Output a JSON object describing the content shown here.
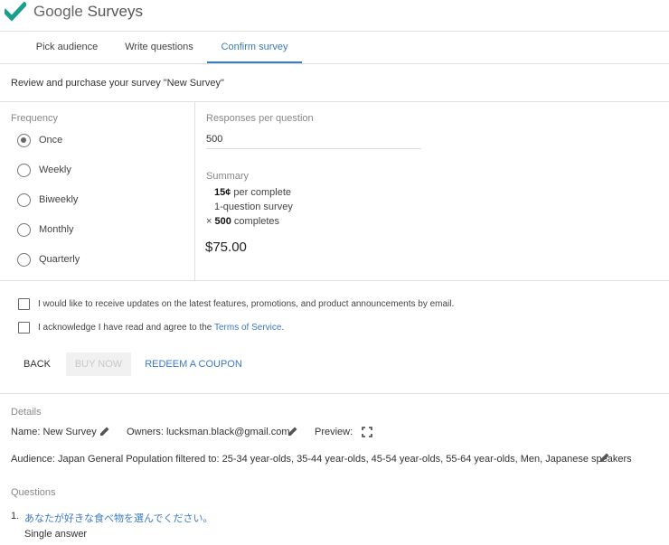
{
  "header": {
    "app_name_google": "Google",
    "app_name_product": "Surveys"
  },
  "tabs": [
    {
      "label": "Pick audience"
    },
    {
      "label": "Write questions"
    },
    {
      "label": "Confirm survey"
    }
  ],
  "review_text": "Review and purchase your survey \"New Survey\"",
  "frequency": {
    "label": "Frequency",
    "options": [
      "Once",
      "Weekly",
      "Biweekly",
      "Monthly",
      "Quarterly"
    ],
    "selected": "Once"
  },
  "responses": {
    "label": "Responses per question",
    "value": "500"
  },
  "summary": {
    "label": "Summary",
    "price_bold": "15¢",
    "price_rest": " per complete",
    "questions_line": "1-question survey",
    "times": "×",
    "completes_bold": "500",
    "completes_rest": " completes",
    "total": "$75.00"
  },
  "checkboxes": {
    "updates": "I would like to receive updates on the latest features, promotions, and product announcements by email.",
    "tos_prefix": "I acknowledge I have read and agree to the ",
    "tos_link": "Terms of Service",
    "tos_suffix": "."
  },
  "buttons": {
    "back": "BACK",
    "buy": "BUY NOW",
    "redeem": "REDEEM A COUPON"
  },
  "details": {
    "label": "Details",
    "name": "Name: New Survey",
    "owners": "Owners: lucksman.black@gmail.com",
    "preview": "Preview:",
    "audience": "Audience: Japan General Population filtered to: 25-34 year-olds, 35-44 year-olds, 45-54 year-olds, 55-64 year-olds, Men, Japanese speakers"
  },
  "questions": {
    "label": "Questions",
    "items": [
      {
        "number": "1.",
        "text": "あなたが好きな食べ物を選んでください。",
        "type": "Single answer"
      }
    ]
  },
  "colors": {
    "accent": "#3c7ac2",
    "logo_check": "#1a9e8e"
  },
  "icons": [
    "checkmark-logo-icon",
    "pencil-icon",
    "expand-icon"
  ]
}
